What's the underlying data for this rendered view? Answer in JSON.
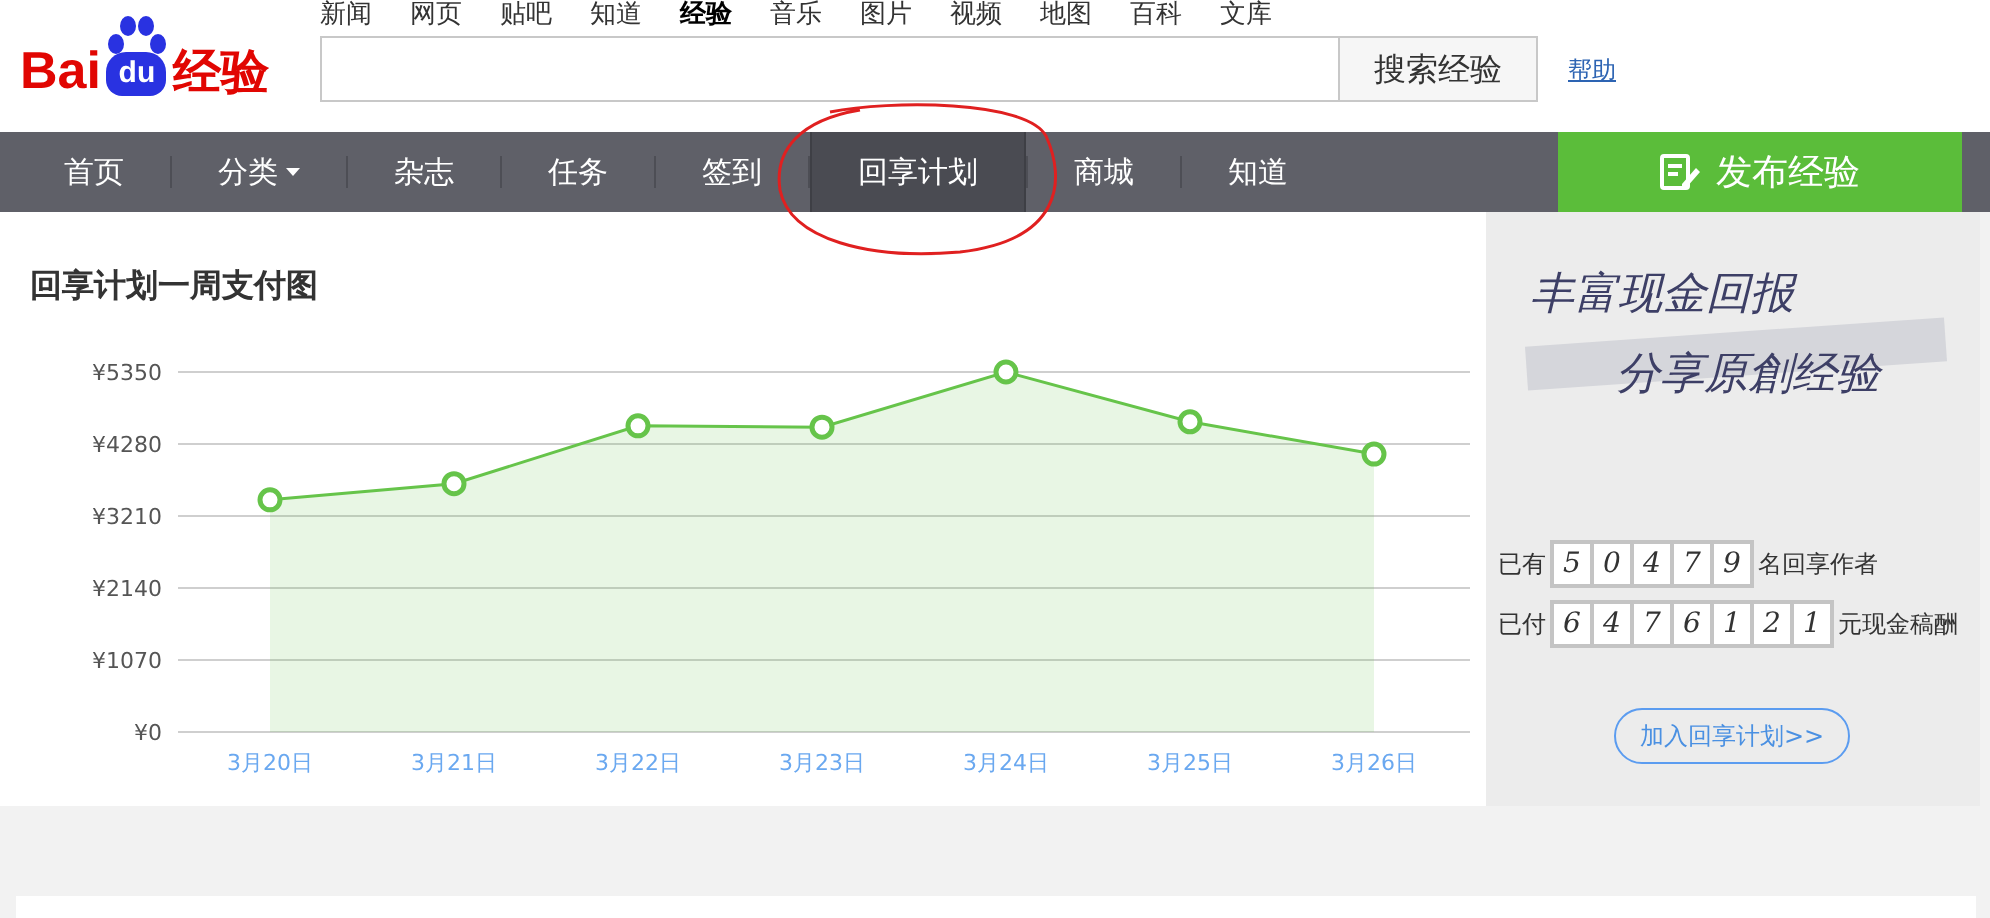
{
  "logo": {
    "part_1": "Bai",
    "part_2": "du",
    "part_3": "经验"
  },
  "top_links": [
    {
      "label": "新闻",
      "selected": false
    },
    {
      "label": "网页",
      "selected": false
    },
    {
      "label": "贴吧",
      "selected": false
    },
    {
      "label": "知道",
      "selected": false
    },
    {
      "label": "经验",
      "selected": true
    },
    {
      "label": "音乐",
      "selected": false
    },
    {
      "label": "图片",
      "selected": false
    },
    {
      "label": "视频",
      "selected": false
    },
    {
      "label": "地图",
      "selected": false
    },
    {
      "label": "百科",
      "selected": false
    },
    {
      "label": "文库",
      "selected": false
    }
  ],
  "search": {
    "button": "搜索经验",
    "help": "帮助"
  },
  "nav": [
    {
      "label": "首页",
      "selected": false
    },
    {
      "label": "分类",
      "selected": false,
      "dropdown": true
    },
    {
      "label": "杂志",
      "selected": false
    },
    {
      "label": "任务",
      "selected": false
    },
    {
      "label": "签到",
      "selected": false
    },
    {
      "label": "回享计划",
      "selected": true
    },
    {
      "label": "商城",
      "selected": false
    },
    {
      "label": "知道",
      "selected": false
    }
  ],
  "publish_button": "发布经验",
  "chart": {
    "title": "回享计划一周支付图",
    "chart_data": {
      "type": "area",
      "grid": true,
      "categories": [
        "3月20日",
        "3月21日",
        "3月22日",
        "3月23日",
        "3月24日",
        "3月25日",
        "3月26日"
      ],
      "series": [
        {
          "color": "#66c44a",
          "values": [
            3450,
            3690,
            4550,
            4530,
            5350,
            4610,
            4130
          ]
        }
      ],
      "ylim": [
        0,
        5350
      ],
      "yticks": [
        {
          "value": 0,
          "label": "¥0"
        },
        {
          "value": 1070,
          "label": "¥1070"
        },
        {
          "value": 2140,
          "label": "¥2140"
        },
        {
          "value": 3210,
          "label": "¥3210"
        },
        {
          "value": 4280,
          "label": "¥4280"
        },
        {
          "value": 5350,
          "label": "¥5350"
        }
      ]
    }
  },
  "side": {
    "banner_line_1": "丰富现金回报",
    "banner_line_2": "分享原創经验",
    "stats": [
      {
        "prefix": "已有",
        "digits": [
          "5",
          "0",
          "4",
          "7",
          "9"
        ],
        "suffix": "名回享作者"
      },
      {
        "prefix": "已付",
        "digits": [
          "6",
          "4",
          "7",
          "6",
          "1",
          "2",
          "1"
        ],
        "suffix": "元现金稿酬"
      }
    ],
    "join_button": "加入回享计划>>"
  }
}
